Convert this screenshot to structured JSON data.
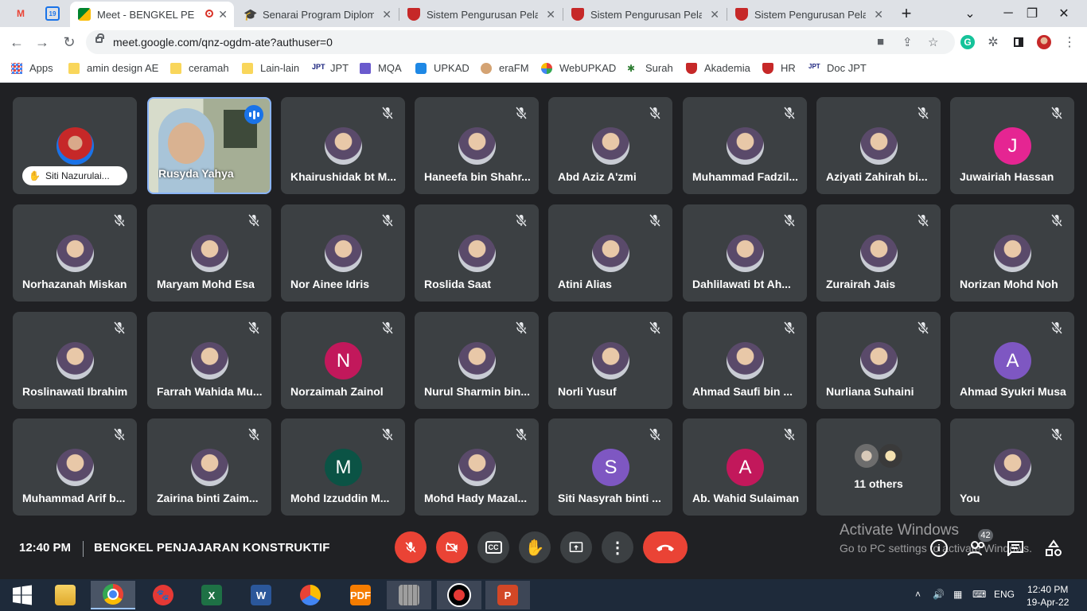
{
  "browser": {
    "tabs": [
      {
        "title": "Meet - BENGKEL PENJAJARAN KONSTRUKTIF",
        "active": true,
        "recording": true
      },
      {
        "title": "Senarai Program Diploma",
        "active": false
      },
      {
        "title": "Sistem Pengurusan Pelajar",
        "active": false
      },
      {
        "title": "Sistem Pengurusan Pelajar",
        "active": false
      },
      {
        "title": "Sistem Pengurusan Pelajar",
        "active": false
      }
    ],
    "pinned_calendar_day": "19",
    "new_tab": "+",
    "url": "meet.google.com/qnz-ogdm-ate?authuser=0",
    "bookmarks": [
      {
        "label": "Apps",
        "icon": "apps-grid-icon"
      },
      {
        "label": "amin design AE",
        "icon": "folder-icon"
      },
      {
        "label": "ceramah",
        "icon": "folder-icon"
      },
      {
        "label": "Lain-lain",
        "icon": "folder-icon"
      },
      {
        "label": "JPT",
        "icon": "jpt-icon"
      },
      {
        "label": "MQA",
        "icon": "mqa-icon"
      },
      {
        "label": "UPKAD",
        "icon": "upkad-icon"
      },
      {
        "label": "eraFM",
        "icon": "erafm-icon"
      },
      {
        "label": "WebUPKAD",
        "icon": "webupkad-icon"
      },
      {
        "label": "Surah",
        "icon": "surah-icon"
      },
      {
        "label": "Akademia",
        "icon": "shield-icon"
      },
      {
        "label": "HR",
        "icon": "shield-icon"
      },
      {
        "label": "Doc JPT",
        "icon": "jpt-icon"
      }
    ]
  },
  "meet": {
    "participants": [
      {
        "name": "Siti Nazurulai...",
        "type": "pill",
        "muted": false,
        "color": "#1a73e8"
      },
      {
        "name": "Rusyda Yahya",
        "type": "video",
        "speaking": true
      },
      {
        "name": "Khairushidak bt M...",
        "type": "photo",
        "muted": true
      },
      {
        "name": "Haneefa bin Shahr...",
        "type": "photo",
        "muted": true
      },
      {
        "name": "Abd Aziz A'zmi",
        "type": "photo",
        "muted": true
      },
      {
        "name": "Muhammad Fadzil...",
        "type": "photo",
        "muted": true
      },
      {
        "name": "Aziyati Zahirah bi...",
        "type": "photo",
        "muted": true
      },
      {
        "name": "Juwairiah Hassan",
        "type": "letter",
        "letter": "J",
        "color": "#e52592",
        "muted": true
      },
      {
        "name": "Norhazanah Miskan",
        "type": "photo",
        "muted": true
      },
      {
        "name": "Maryam Mohd Esa",
        "type": "photo",
        "muted": true
      },
      {
        "name": "Nor Ainee Idris",
        "type": "photo",
        "muted": true
      },
      {
        "name": "Roslida Saat",
        "type": "photo",
        "muted": true
      },
      {
        "name": "Atini Alias",
        "type": "photo",
        "muted": true
      },
      {
        "name": "Dahlilawati bt Ah...",
        "type": "photo",
        "muted": true
      },
      {
        "name": "Zurairah Jais",
        "type": "photo",
        "muted": true
      },
      {
        "name": "Norizan Mohd Noh",
        "type": "photo",
        "muted": true
      },
      {
        "name": "Roslinawati Ibrahim",
        "type": "photo",
        "muted": true
      },
      {
        "name": "Farrah Wahida Mu...",
        "type": "photo",
        "muted": true
      },
      {
        "name": "Norzaimah Zainol",
        "type": "letter",
        "letter": "N",
        "color": "#c2185b",
        "muted": true
      },
      {
        "name": "Nurul Sharmin bin...",
        "type": "photo",
        "muted": true
      },
      {
        "name": "Norli Yusuf",
        "type": "photo",
        "muted": true
      },
      {
        "name": "Ahmad Saufi bin ...",
        "type": "photo",
        "muted": true
      },
      {
        "name": "Nurliana Suhaini",
        "type": "photo",
        "muted": true
      },
      {
        "name": "Ahmad Syukri Musa",
        "type": "letter",
        "letter": "A",
        "color": "#7e57c2",
        "muted": true
      },
      {
        "name": "Muhammad Arif b...",
        "type": "photo",
        "muted": true
      },
      {
        "name": "Zairina binti Zaim...",
        "type": "photo",
        "muted": true
      },
      {
        "name": "Mohd Izzuddin M...",
        "type": "letter",
        "letter": "M",
        "color": "#0b5345",
        "muted": true
      },
      {
        "name": "Mohd Hady Mazal...",
        "type": "photo",
        "muted": true
      },
      {
        "name": "Siti Nasyrah binti ...",
        "type": "letter",
        "letter": "S",
        "color": "#7e57c2",
        "muted": true
      },
      {
        "name": "Ab. Wahid Sulaiman",
        "type": "letter",
        "letter": "A",
        "color": "#c2185b",
        "muted": true
      },
      {
        "name": "11 others",
        "type": "others"
      },
      {
        "name": "You",
        "type": "photo",
        "muted": true
      }
    ],
    "time": "12:40 PM",
    "meeting_title": "BENGKEL PENJAJARAN KONSTRUKTIF",
    "participant_count": "42",
    "watermark": {
      "line1": "Activate Windows",
      "line2": "Go to PC settings to activate Windows."
    }
  },
  "taskbar": {
    "lang": "ENG",
    "time": "12:40 PM",
    "date": "19-Apr-22"
  }
}
